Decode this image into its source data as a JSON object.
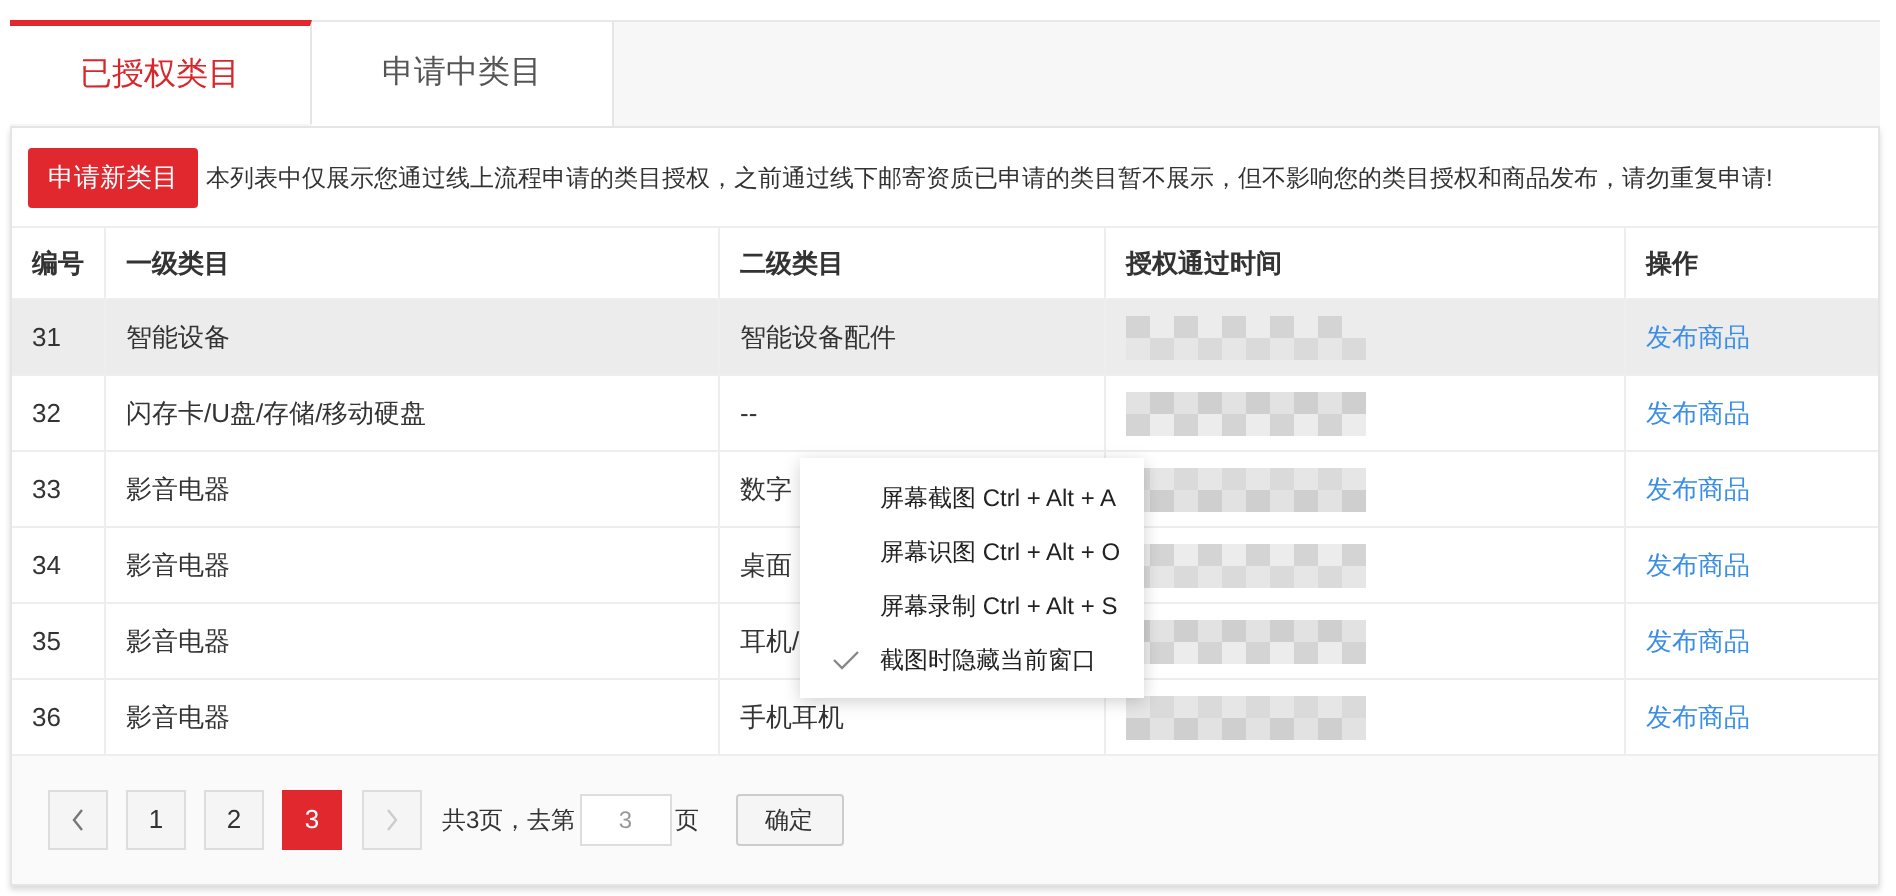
{
  "tabs": [
    {
      "label": "已授权类目",
      "selected": true
    },
    {
      "label": "申请中类目",
      "selected": false
    }
  ],
  "apply_button": "申请新类目",
  "notice": "本列表中仅展示您通过线上流程申请的类目授权，之前通过线下邮寄资质已申请的类目暂不展示，但不影响您的类目授权和商品发布，请勿重复申请!",
  "table": {
    "columns": [
      "编号",
      "一级类目",
      "二级类目",
      "授权通过时间",
      "操作"
    ],
    "rows": [
      {
        "id": "31",
        "level1": "智能设备",
        "level2": "智能设备配件",
        "action": "发布商品",
        "highlighted": true
      },
      {
        "id": "32",
        "level1": "闪存卡/U盘/存储/移动硬盘",
        "level2": "--",
        "action": "发布商品",
        "highlighted": false
      },
      {
        "id": "33",
        "level1": "影音电器",
        "level2": "数字",
        "action": "发布商品",
        "highlighted": false
      },
      {
        "id": "34",
        "level1": "影音电器",
        "level2": "桌面",
        "action": "发布商品",
        "highlighted": false
      },
      {
        "id": "35",
        "level1": "影音电器",
        "level2": "耳机/",
        "action": "发布商品",
        "highlighted": false
      },
      {
        "id": "36",
        "level1": "影音电器",
        "level2": "手机耳机",
        "action": "发布商品",
        "highlighted": false
      }
    ]
  },
  "pagination": {
    "prev": {
      "disabled": false
    },
    "pages": [
      {
        "label": "1",
        "selected": false
      },
      {
        "label": "2",
        "selected": false
      },
      {
        "label": "3",
        "selected": true
      }
    ],
    "next": {
      "disabled": true
    },
    "total_text": "共3页，去第",
    "page_input": "3",
    "page_suffix": "页",
    "confirm": "确定"
  },
  "context_menu": [
    {
      "label": "屏幕截图 Ctrl + Alt + A",
      "checked": false
    },
    {
      "label": "屏幕识图 Ctrl + Alt + O",
      "checked": false
    },
    {
      "label": "屏幕录制 Ctrl + Alt + S",
      "checked": false
    },
    {
      "label": "截图时隐藏当前窗口",
      "checked": true
    }
  ]
}
